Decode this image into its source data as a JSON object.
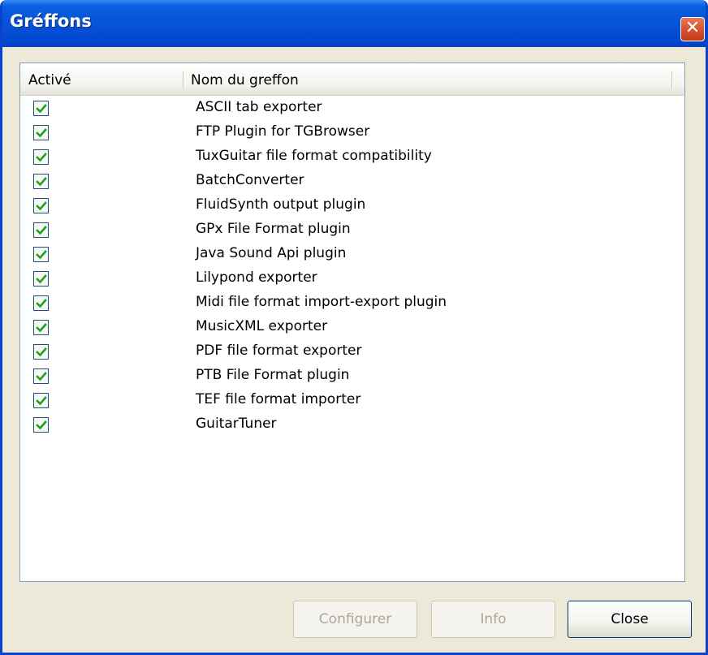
{
  "window": {
    "title": "Gréffons",
    "close_glyph": "✕"
  },
  "table": {
    "headers": [
      "Activé",
      "Nom du greffon"
    ],
    "rows": [
      {
        "enabled": true,
        "name": "ASCII tab exporter"
      },
      {
        "enabled": true,
        "name": "FTP Plugin for TGBrowser"
      },
      {
        "enabled": true,
        "name": "TuxGuitar file format compatibility"
      },
      {
        "enabled": true,
        "name": "BatchConverter"
      },
      {
        "enabled": true,
        "name": "FluidSynth output plugin"
      },
      {
        "enabled": true,
        "name": "GPx File Format plugin"
      },
      {
        "enabled": true,
        "name": "Java Sound Api plugin"
      },
      {
        "enabled": true,
        "name": "Lilypond exporter"
      },
      {
        "enabled": true,
        "name": "Midi file format import-export plugin"
      },
      {
        "enabled": true,
        "name": "MusicXML exporter"
      },
      {
        "enabled": true,
        "name": "PDF file format exporter"
      },
      {
        "enabled": true,
        "name": "PTB File Format plugin"
      },
      {
        "enabled": true,
        "name": "TEF file format importer"
      },
      {
        "enabled": true,
        "name": "GuitarTuner"
      }
    ]
  },
  "buttons": {
    "configure": {
      "label": "Configurer",
      "enabled": false
    },
    "info": {
      "label": "Info",
      "enabled": false
    },
    "close": {
      "label": "Close",
      "enabled": true
    }
  },
  "colors": {
    "titlebar": "#0653d8",
    "dialog_bg": "#ece9d8",
    "check": "#21a121",
    "close_button": "#d8532f"
  }
}
